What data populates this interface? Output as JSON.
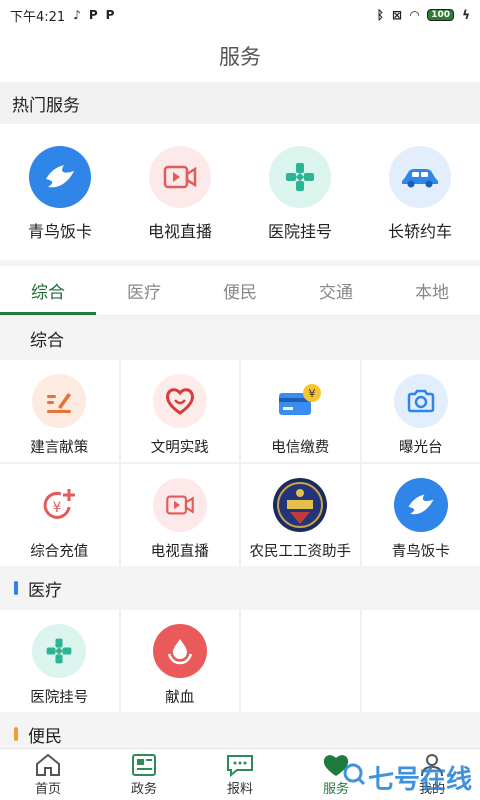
{
  "status_bar": {
    "time": "下午4:21",
    "battery": "100"
  },
  "header": {
    "title": "服务"
  },
  "hot": {
    "heading": "热门服务",
    "items": [
      {
        "label": "青鸟饭卡",
        "icon": "bird-icon"
      },
      {
        "label": "电视直播",
        "icon": "video-icon"
      },
      {
        "label": "医院挂号",
        "icon": "medical-cross-icon"
      },
      {
        "label": "长轿约车",
        "icon": "car-icon"
      }
    ]
  },
  "tabs": [
    "综合",
    "医疗",
    "便民",
    "交通",
    "本地"
  ],
  "sections": {
    "zonghe": {
      "title": "综合",
      "items": [
        {
          "label": "建言献策",
          "icon": "pen-icon"
        },
        {
          "label": "文明实践",
          "icon": "heart-icon"
        },
        {
          "label": "电信缴费",
          "icon": "card-yuan-icon"
        },
        {
          "label": "曝光台",
          "icon": "camera-icon"
        },
        {
          "label": "综合充值",
          "icon": "recharge-icon"
        },
        {
          "label": "电视直播",
          "icon": "video-icon"
        },
        {
          "label": "农民工工资助手",
          "icon": "labor-badge-icon"
        },
        {
          "label": "青鸟饭卡",
          "icon": "bird-icon"
        }
      ]
    },
    "yiliao": {
      "title": "医疗",
      "items": [
        {
          "label": "医院挂号",
          "icon": "medical-cross-icon"
        },
        {
          "label": "献血",
          "icon": "blood-drop-icon"
        }
      ]
    },
    "bianmin": {
      "title": "便民"
    }
  },
  "bottom_nav": [
    {
      "label": "首页",
      "icon": "home-icon"
    },
    {
      "label": "政务",
      "icon": "news-icon"
    },
    {
      "label": "报料",
      "icon": "chat-icon"
    },
    {
      "label": "服务",
      "icon": "heart-service-icon"
    },
    {
      "label": "我的",
      "icon": "user-icon"
    }
  ],
  "watermark": "七号在线",
  "colors": {
    "accent": "#1f7a3d",
    "medical_bar": "#2f80ed",
    "bianmin_bar": "#f2a02d"
  }
}
